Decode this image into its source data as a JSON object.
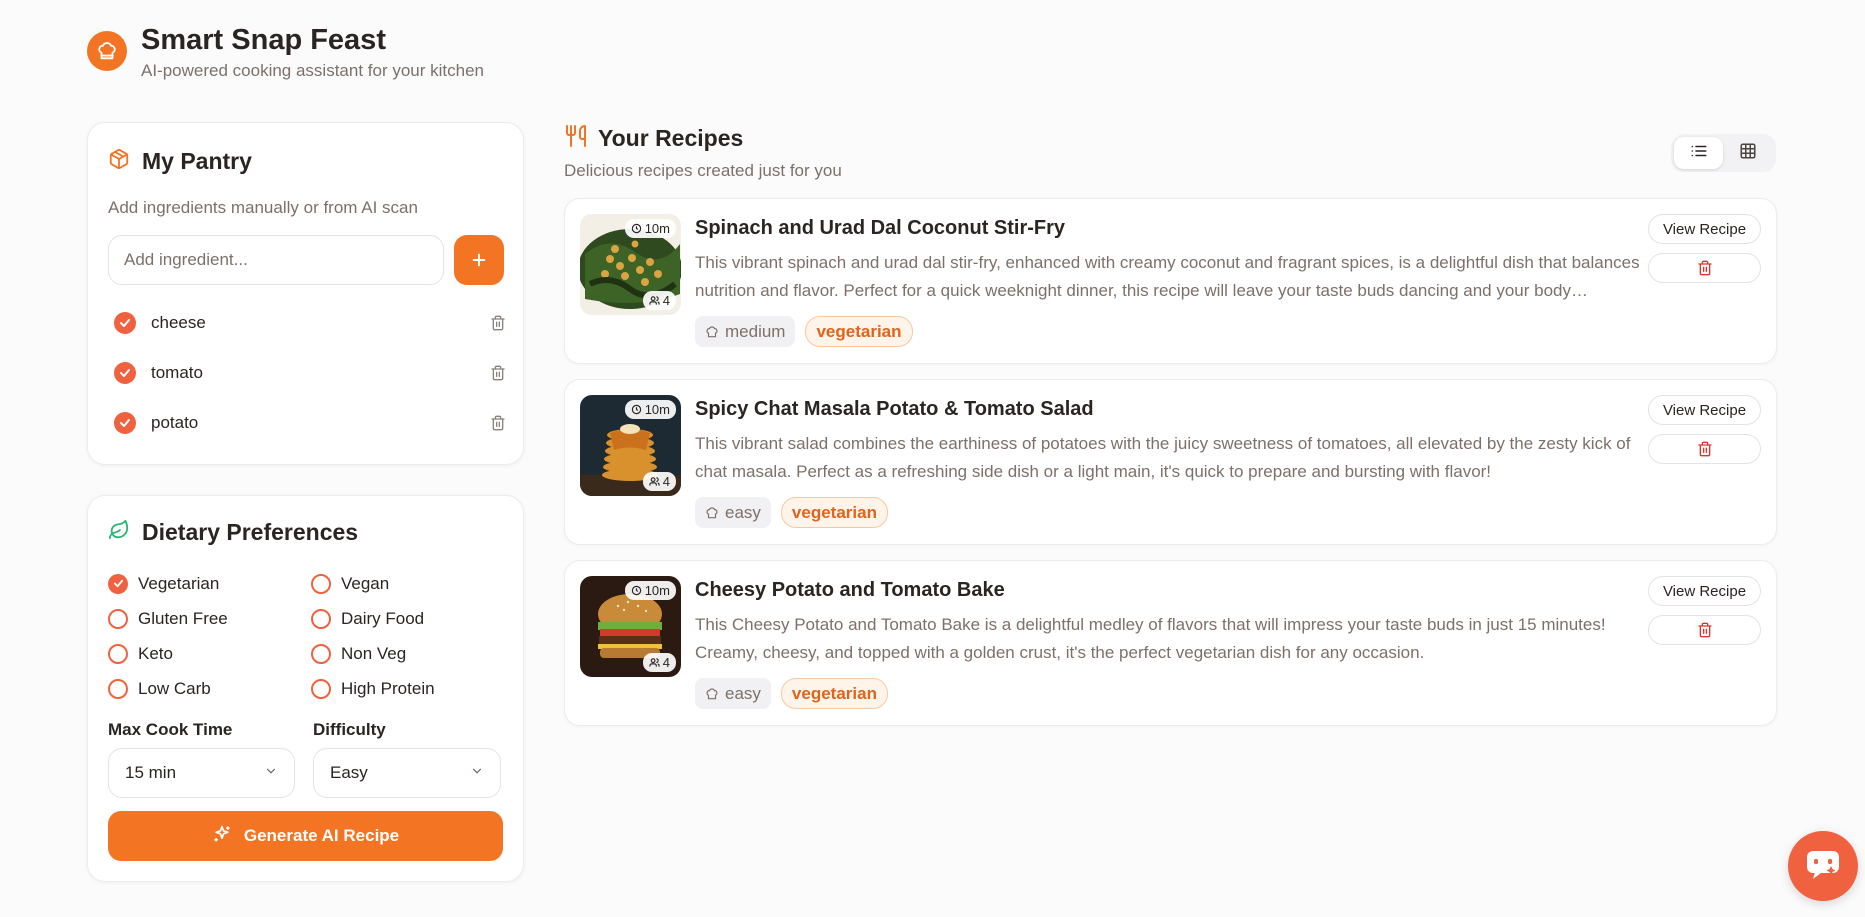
{
  "app": {
    "title": "Smart Snap Feast",
    "subtitle": "AI-powered cooking assistant for your kitchen",
    "accent": "#f37422"
  },
  "pantry": {
    "title": "My Pantry",
    "subtitle": "Add ingredients manually or from AI scan",
    "input_placeholder": "Add ingredient...",
    "items": [
      {
        "name": "cheese",
        "checked": true
      },
      {
        "name": "tomato",
        "checked": true
      },
      {
        "name": "potato",
        "checked": true
      }
    ]
  },
  "diet": {
    "title": "Dietary Preferences",
    "options": [
      {
        "label": "Vegetarian",
        "checked": true
      },
      {
        "label": "Vegan",
        "checked": false
      },
      {
        "label": "Gluten Free",
        "checked": false
      },
      {
        "label": "Dairy Food",
        "checked": false
      },
      {
        "label": "Keto",
        "checked": false
      },
      {
        "label": "Non Veg",
        "checked": false
      },
      {
        "label": "Low Carb",
        "checked": false
      },
      {
        "label": "High Protein",
        "checked": false
      }
    ],
    "max_cook_time_label": "Max Cook Time",
    "max_cook_time_value": "15 min",
    "difficulty_label": "Difficulty",
    "difficulty_value": "Easy",
    "generate_label": "Generate AI Recipe"
  },
  "recipes": {
    "title": "Your Recipes",
    "subtitle": "Delicious recipes created just for you",
    "view_mode": "list",
    "view_button_label": "View Recipe",
    "items": [
      {
        "title": "Spinach and Urad Dal Coconut Stir-Fry",
        "description": "This vibrant spinach and urad dal stir-fry, enhanced with creamy coconut and fragrant spices, is a delightful dish that balances nutrition and flavor. Perfect for a quick weeknight dinner, this recipe will leave your taste buds dancing and your body nourished.",
        "time": "10m",
        "servings": "4",
        "difficulty": "medium",
        "tag": "vegetarian",
        "image": "stir-fry-photo"
      },
      {
        "title": "Spicy Chat Masala Potato & Tomato Salad",
        "description": "This vibrant salad combines the earthiness of potatoes with the juicy sweetness of tomatoes, all elevated by the zesty kick of chat masala. Perfect as a refreshing side dish or a light main, it's quick to prepare and bursting with flavor!",
        "time": "10m",
        "servings": "4",
        "difficulty": "easy",
        "tag": "vegetarian",
        "image": "pancake-stack-photo"
      },
      {
        "title": "Cheesy Potato and Tomato Bake",
        "description": "This Cheesy Potato and Tomato Bake is a delightful medley of flavors that will impress your taste buds in just 15 minutes! Creamy, cheesy, and topped with a golden crust, it's the perfect vegetarian dish for any occasion.",
        "time": "10m",
        "servings": "4",
        "difficulty": "easy",
        "tag": "vegetarian",
        "image": "burger-photo"
      }
    ]
  }
}
